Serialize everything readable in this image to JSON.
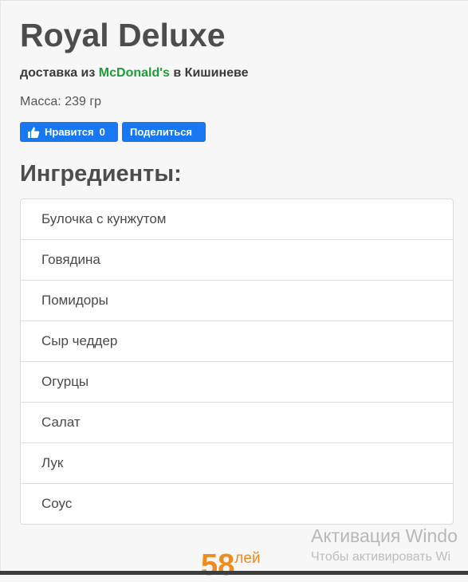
{
  "product": {
    "title": "Royal Deluxe",
    "delivery_prefix": "доставка из",
    "brand": "McDonald's",
    "delivery_suffix": "в Кишиневе",
    "mass": "Масса: 239 гр"
  },
  "social": {
    "like_label": "Нравится",
    "like_count": "0",
    "share_label": "Поделиться"
  },
  "ingredients": {
    "heading": "Ингредиенты:",
    "items": [
      "Булочка с кунжутом",
      "Говядина",
      "Помидоры",
      "Сыр чеддер",
      "Огурцы",
      "Салат",
      "Лук",
      "Соус"
    ]
  },
  "price": {
    "value": "58",
    "currency": "лей"
  },
  "watermark": {
    "title": "Активация Windo",
    "subtitle": "Чтобы активировать Wi"
  },
  "colors": {
    "brand": "#1f9d3a",
    "facebook": "#1877f2",
    "price": "#f28a1c"
  },
  "icons": {
    "like": "thumbs-up-icon"
  }
}
